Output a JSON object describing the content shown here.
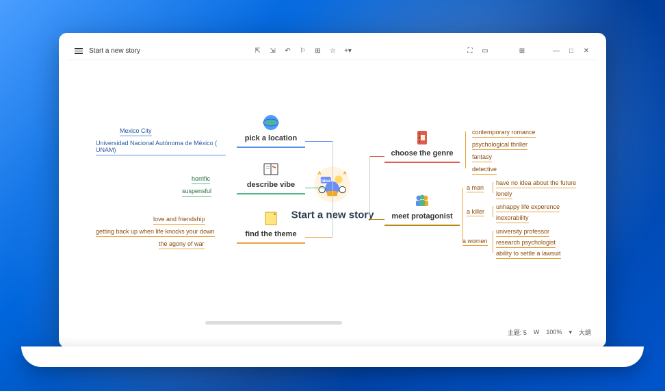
{
  "titlebar": {
    "title": "Start a new story"
  },
  "central": {
    "label": "Start a new story"
  },
  "stems": {
    "location": {
      "label": "pick a location",
      "color": "#5b8def",
      "leaves": [
        "Mexico City",
        "Universidad Nacional Autónoma de México ( UNAM)"
      ]
    },
    "vibe": {
      "label": "describe vibe",
      "color": "#52b788",
      "leaves": [
        "horrific",
        "suspensful"
      ]
    },
    "theme": {
      "label": "find the theme",
      "color": "#e6a23c",
      "leaves": [
        "love and friendship",
        "getting back up when life knocks your down",
        "the agony of war"
      ]
    },
    "genre": {
      "label": "choose the genre",
      "color": "#e05b4c",
      "leaves": [
        "contemporary romance",
        "psychological thriller",
        "fantasy",
        "detective"
      ]
    },
    "protagonist": {
      "label": "meet protagonist",
      "color": "#b8860b",
      "subs": [
        {
          "label": "a  man",
          "leaves": [
            "have no idea about the future",
            "lonely"
          ]
        },
        {
          "label": "a  killer",
          "leaves": [
            "unhappy life experence",
            "inexorability"
          ]
        },
        {
          "label": "a  women",
          "leaves": [
            "university professor",
            "research psychologist",
            "ability to settle a lawsuit"
          ]
        }
      ]
    }
  },
  "status": {
    "topic_label": "主题: 5",
    "word_icon": "W",
    "zoom": "100%",
    "outline": "大纲"
  }
}
